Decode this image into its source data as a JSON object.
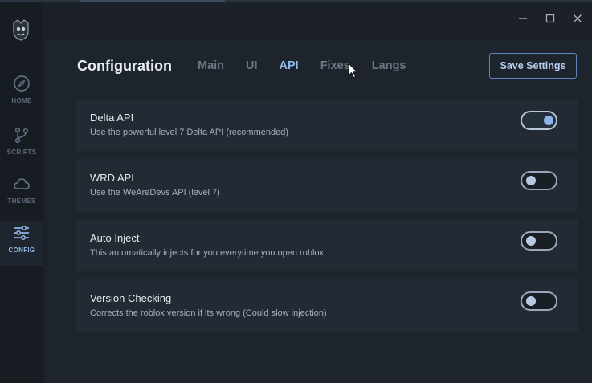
{
  "window": {
    "controls": [
      "minimize",
      "maximize",
      "close"
    ]
  },
  "sidebar": {
    "items": [
      {
        "label": "HOME",
        "icon": "compass-icon",
        "active": false
      },
      {
        "label": "SCRIPTS",
        "icon": "branch-icon",
        "active": false
      },
      {
        "label": "THEMES",
        "icon": "cloud-icon",
        "active": false
      },
      {
        "label": "CONFIG",
        "icon": "sliders-icon",
        "active": true
      }
    ]
  },
  "header": {
    "title": "Configuration",
    "tabs": [
      {
        "label": "Main",
        "active": false
      },
      {
        "label": "UI",
        "active": false
      },
      {
        "label": "API",
        "active": true
      },
      {
        "label": "Fixes",
        "active": false
      },
      {
        "label": "Langs",
        "active": false
      }
    ],
    "save_label": "Save Settings"
  },
  "settings": [
    {
      "title": "Delta API",
      "description": "Use the powerful level 7 Delta API (recommended)",
      "enabled": true
    },
    {
      "title": "WRD API",
      "description": "Use the WeAreDevs API (level 7)",
      "enabled": false
    },
    {
      "title": "Auto Inject",
      "description": "This automatically injects for you everytime you open roblox",
      "enabled": false
    },
    {
      "title": "Version Checking",
      "description": "Corrects the roblox version if its wrong (Could slow injection)",
      "enabled": false
    }
  ],
  "colors": {
    "accent": "#8eb7ee",
    "background": "#1c2129",
    "card": "#232a33"
  }
}
